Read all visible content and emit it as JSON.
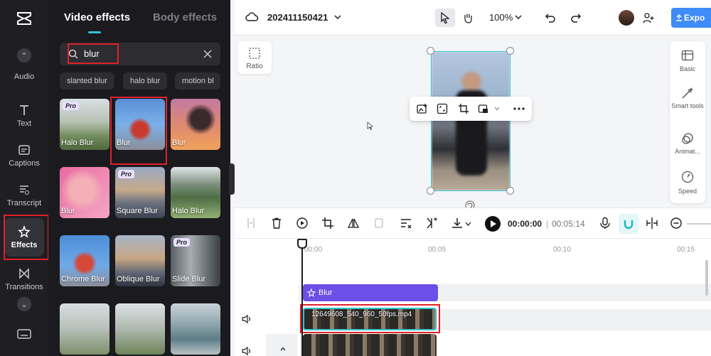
{
  "rail": {
    "items": [
      {
        "label": "Audio"
      },
      {
        "label": "Text"
      },
      {
        "label": "Captions"
      },
      {
        "label": "Transcript"
      },
      {
        "label": "Effects"
      },
      {
        "label": "Transitions"
      }
    ]
  },
  "panel": {
    "tab_video": "Video effects",
    "tab_body": "Body effects",
    "search_value": "blur",
    "chips": [
      "slanted blur",
      "halo blur",
      "motion bl"
    ],
    "pro_badge": "Pro",
    "tiles": [
      {
        "label": "Halo Blur",
        "pro": true
      },
      {
        "label": "Blur",
        "pro": false
      },
      {
        "label": "Blur",
        "pro": false
      },
      {
        "label": "Blur",
        "pro": false
      },
      {
        "label": "Square Blur",
        "pro": true
      },
      {
        "label": "Halo Blur",
        "pro": false
      },
      {
        "label": "Chrome Blur",
        "pro": false
      },
      {
        "label": "Oblique Blur",
        "pro": false
      },
      {
        "label": "Slide Blur",
        "pro": true
      },
      {
        "label": "",
        "pro": false
      },
      {
        "label": "",
        "pro": false
      },
      {
        "label": "",
        "pro": false
      }
    ]
  },
  "topbar": {
    "project_name": "202411150421",
    "zoom": "100%",
    "export_label": "Expo"
  },
  "canvas": {
    "ratio_label": "Ratio"
  },
  "right_panel": {
    "items": [
      "Basic",
      "Smart tools",
      "Animat...",
      "Speed"
    ]
  },
  "timeline": {
    "current_time": "00:00:00",
    "total_time": "00:05:14",
    "ticks": [
      "00:00",
      "00:05",
      "00:10",
      "00:15"
    ],
    "effect_clip": "Blur",
    "video_clip": "12649608_540_960_50fps.mp4"
  }
}
